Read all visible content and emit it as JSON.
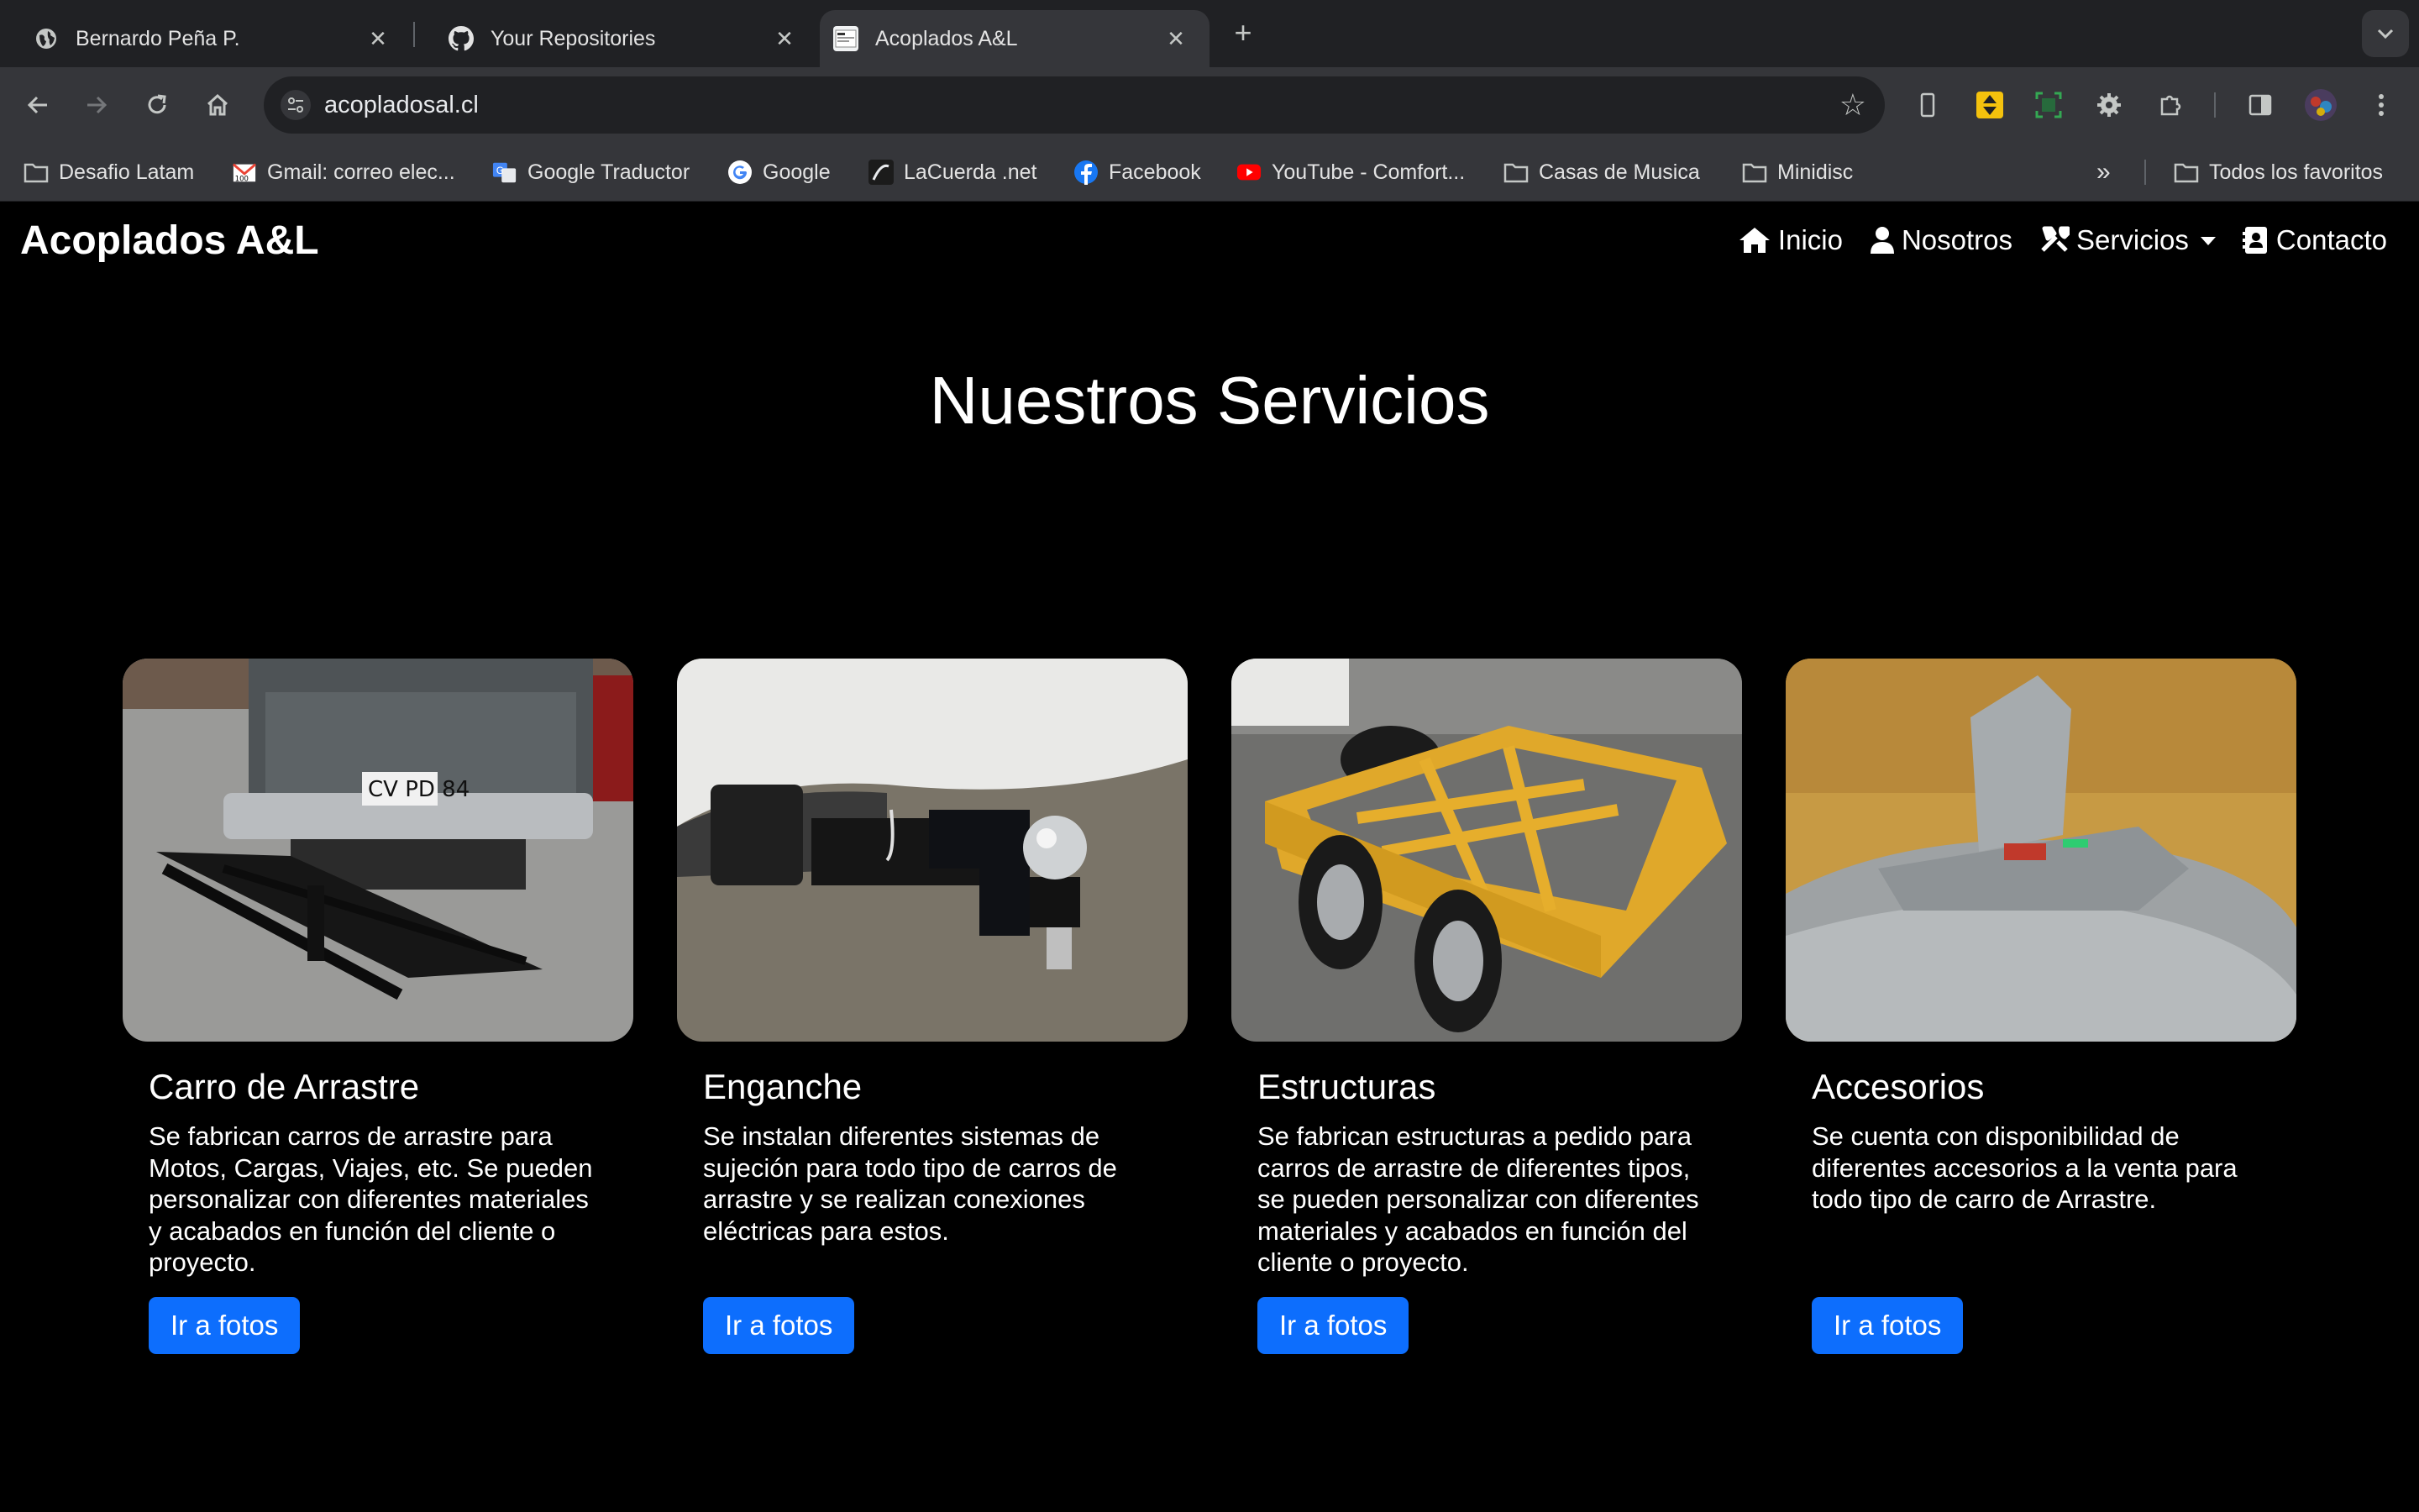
{
  "browser": {
    "tabs": [
      {
        "title": "Bernardo Peña P.",
        "icon": "globe-icon",
        "active": false
      },
      {
        "title": "Your Repositories",
        "icon": "github-icon",
        "active": false
      },
      {
        "title": "Acoplados A&L",
        "icon": "site-favicon",
        "active": true
      }
    ],
    "url": "acopladosal.cl",
    "bookmarks": [
      {
        "label": "Desafio Latam",
        "icon": "folder-icon"
      },
      {
        "label": "Gmail: correo elec...",
        "icon": "gmail-icon"
      },
      {
        "label": "Google Traductor",
        "icon": "translate-icon"
      },
      {
        "label": "Google",
        "icon": "google-icon"
      },
      {
        "label": "LaCuerda .net",
        "icon": "lacuerda-icon"
      },
      {
        "label": "Facebook",
        "icon": "facebook-icon"
      },
      {
        "label": "YouTube - Comfort...",
        "icon": "youtube-icon"
      },
      {
        "label": "Casas de Musica",
        "icon": "folder-icon"
      },
      {
        "label": "Minidisc",
        "icon": "folder-icon"
      }
    ],
    "more_bookmarks": "»",
    "all_bookmarks": "Todos los favoritos"
  },
  "site": {
    "brand": "Acoplados A&L",
    "nav": [
      {
        "label": "Inicio",
        "icon": "home-icon"
      },
      {
        "label": "Nosotros",
        "icon": "user-icon"
      },
      {
        "label": "Servicios",
        "icon": "tools-icon",
        "dropdown": true
      },
      {
        "label": "Contacto",
        "icon": "contact-card-icon"
      }
    ],
    "section_title": "Nuestros Servicios",
    "services": [
      {
        "title": "Carro de Arrastre",
        "text": "Se fabrican carros de arrastre para Motos, Cargas, Viajes, etc. Se pueden personalizar con diferentes materiales y acabados en función del cliente o proyecto.",
        "button": "Ir a fotos"
      },
      {
        "title": "Enganche",
        "text": "Se instalan diferentes sistemas de sujeción para todo tipo de carros de arrastre y se realizan conexiones eléctricas para estos.",
        "button": "Ir a fotos"
      },
      {
        "title": "Estructuras",
        "text": "Se fabrican estructuras a pedido para carros de arrastre de diferentes tipos, se pueden personalizar con diferentes materiales y acabados en función del cliente o proyecto.",
        "button": "Ir a fotos"
      },
      {
        "title": "Accesorios",
        "text": "Se cuenta con disponibilidad de diferentes accesorios a la venta para todo tipo de carro de Arrastre.",
        "button": "Ir a fotos"
      }
    ]
  },
  "colors": {
    "tabstrip_bg": "#202124",
    "toolbar_bg": "#35363a",
    "page_bg": "#000000",
    "button_bg": "#0d6efd",
    "text": "#ffffff"
  }
}
